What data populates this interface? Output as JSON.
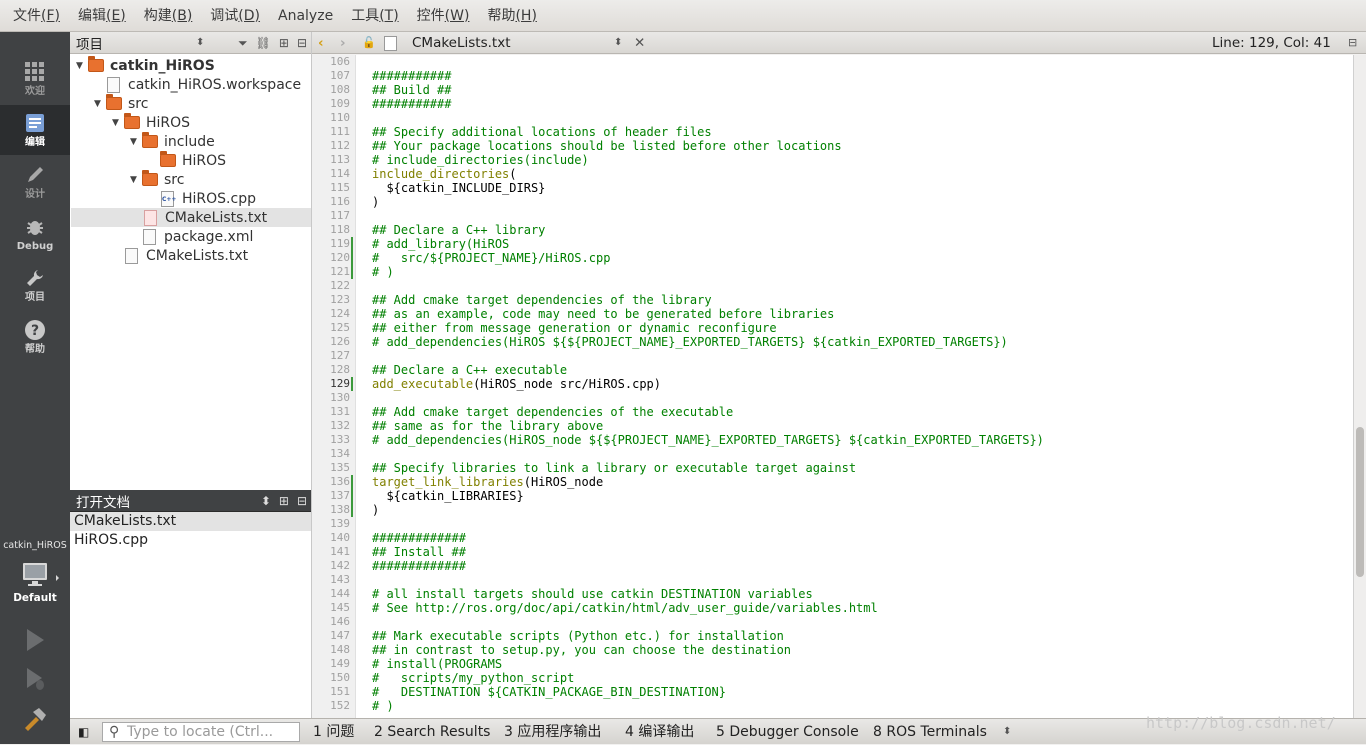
{
  "menubar": {
    "items": [
      {
        "label": "文件",
        "key": "(F)"
      },
      {
        "label": "编辑",
        "key": "(E)"
      },
      {
        "label": "构建",
        "key": "(B)"
      },
      {
        "label": "调试",
        "key": "(D)"
      },
      {
        "label": "Analyze",
        "key": ""
      },
      {
        "label": "工具",
        "key": "(T)"
      },
      {
        "label": "控件",
        "key": "(W)"
      },
      {
        "label": "帮助",
        "key": "(H)"
      }
    ]
  },
  "modes": {
    "welcome": "欢迎",
    "edit": "编辑",
    "design": "设计",
    "debug": "Debug",
    "projects": "项目",
    "help": "帮助"
  },
  "kit": {
    "project": "catkin_HiROS",
    "build": "Default"
  },
  "project_pane": {
    "title": "项目",
    "tree": [
      {
        "label": "catkin_HiROS",
        "type": "folder",
        "depth": 0,
        "expanded": true,
        "bold": true
      },
      {
        "label": "catkin_HiROS.workspace",
        "type": "file",
        "depth": 1
      },
      {
        "label": "src",
        "type": "folder",
        "depth": 1,
        "expanded": true
      },
      {
        "label": "HiROS",
        "type": "folder",
        "depth": 2,
        "expanded": true
      },
      {
        "label": "include",
        "type": "folder",
        "depth": 3,
        "expanded": true
      },
      {
        "label": "HiROS",
        "type": "folder",
        "depth": 4
      },
      {
        "label": "src",
        "type": "folder",
        "depth": 3,
        "expanded": true
      },
      {
        "label": "HiROS.cpp",
        "type": "cpp",
        "depth": 4
      },
      {
        "label": "CMakeLists.txt",
        "type": "cmake",
        "depth": 3,
        "selected": true
      },
      {
        "label": "package.xml",
        "type": "file",
        "depth": 3
      },
      {
        "label": "CMakeLists.txt",
        "type": "file",
        "depth": 2
      }
    ]
  },
  "open_docs": {
    "title": "打开文档",
    "items": [
      "CMakeLists.txt",
      "HiROS.cpp"
    ]
  },
  "editor": {
    "filename": "CMakeLists.txt",
    "position": "Line: 129, Col: 41",
    "current_line": 129,
    "lines": [
      {
        "n": 106,
        "t": ""
      },
      {
        "n": 107,
        "t": "###########"
      },
      {
        "n": 108,
        "t": "## Build ##"
      },
      {
        "n": 109,
        "t": "###########"
      },
      {
        "n": 110,
        "t": ""
      },
      {
        "n": 111,
        "t": "## Specify additional locations of header files"
      },
      {
        "n": 112,
        "t": "## Your package locations should be listed before other locations"
      },
      {
        "n": 113,
        "t": "# include_directories(include)"
      },
      {
        "n": 114,
        "t": "include_directories(",
        "kw": "include_directories"
      },
      {
        "n": 115,
        "t": "  ${catkin_INCLUDE_DIRS}",
        "plain": true
      },
      {
        "n": 116,
        "t": ")",
        "plain": true
      },
      {
        "n": 117,
        "t": ""
      },
      {
        "n": 118,
        "t": "## Declare a C++ library"
      },
      {
        "n": 119,
        "t": "# add_library(HiROS",
        "mark": true
      },
      {
        "n": 120,
        "t": "#   src/${PROJECT_NAME}/HiROS.cpp",
        "mark": true
      },
      {
        "n": 121,
        "t": "# )",
        "mark": true
      },
      {
        "n": 122,
        "t": ""
      },
      {
        "n": 123,
        "t": "## Add cmake target dependencies of the library"
      },
      {
        "n": 124,
        "t": "## as an example, code may need to be generated before libraries"
      },
      {
        "n": 125,
        "t": "## either from message generation or dynamic reconfigure"
      },
      {
        "n": 126,
        "t": "# add_dependencies(HiROS ${${PROJECT_NAME}_EXPORTED_TARGETS} ${catkin_EXPORTED_TARGETS})"
      },
      {
        "n": 127,
        "t": ""
      },
      {
        "n": 128,
        "t": "## Declare a C++ executable"
      },
      {
        "n": 129,
        "t": "add_executable(HiROS_node src/HiROS.cpp)",
        "kw": "add_executable",
        "mark": true
      },
      {
        "n": 130,
        "t": ""
      },
      {
        "n": 131,
        "t": "## Add cmake target dependencies of the executable"
      },
      {
        "n": 132,
        "t": "## same as for the library above"
      },
      {
        "n": 133,
        "t": "# add_dependencies(HiROS_node ${${PROJECT_NAME}_EXPORTED_TARGETS} ${catkin_EXPORTED_TARGETS})"
      },
      {
        "n": 134,
        "t": ""
      },
      {
        "n": 135,
        "t": "## Specify libraries to link a library or executable target against"
      },
      {
        "n": 136,
        "t": "target_link_libraries(HiROS_node",
        "kw": "target_link_libraries",
        "mark": true
      },
      {
        "n": 137,
        "t": "  ${catkin_LIBRARIES}",
        "plain": true,
        "mark": true
      },
      {
        "n": 138,
        "t": ")",
        "plain": true,
        "mark": true
      },
      {
        "n": 139,
        "t": ""
      },
      {
        "n": 140,
        "t": "#############"
      },
      {
        "n": 141,
        "t": "## Install ##"
      },
      {
        "n": 142,
        "t": "#############"
      },
      {
        "n": 143,
        "t": ""
      },
      {
        "n": 144,
        "t": "# all install targets should use catkin DESTINATION variables"
      },
      {
        "n": 145,
        "t": "# See http://ros.org/doc/api/catkin/html/adv_user_guide/variables.html"
      },
      {
        "n": 146,
        "t": ""
      },
      {
        "n": 147,
        "t": "## Mark executable scripts (Python etc.) for installation"
      },
      {
        "n": 148,
        "t": "## in contrast to setup.py, you can choose the destination"
      },
      {
        "n": 149,
        "t": "# install(PROGRAMS"
      },
      {
        "n": 150,
        "t": "#   scripts/my_python_script"
      },
      {
        "n": 151,
        "t": "#   DESTINATION ${CATKIN_PACKAGE_BIN_DESTINATION}"
      },
      {
        "n": 152,
        "t": "# )"
      }
    ]
  },
  "statusbar": {
    "locator_placeholder": "Type to locate (Ctrl...",
    "tabs": [
      {
        "num": "1",
        "label": "问题"
      },
      {
        "num": "2",
        "label": "Search Results"
      },
      {
        "num": "3",
        "label": "应用程序输出"
      },
      {
        "num": "4",
        "label": "编译输出"
      },
      {
        "num": "5",
        "label": "Debugger Console"
      },
      {
        "num": "8",
        "label": "ROS Terminals"
      }
    ]
  },
  "watermark": "http://blog.csdn.net/"
}
